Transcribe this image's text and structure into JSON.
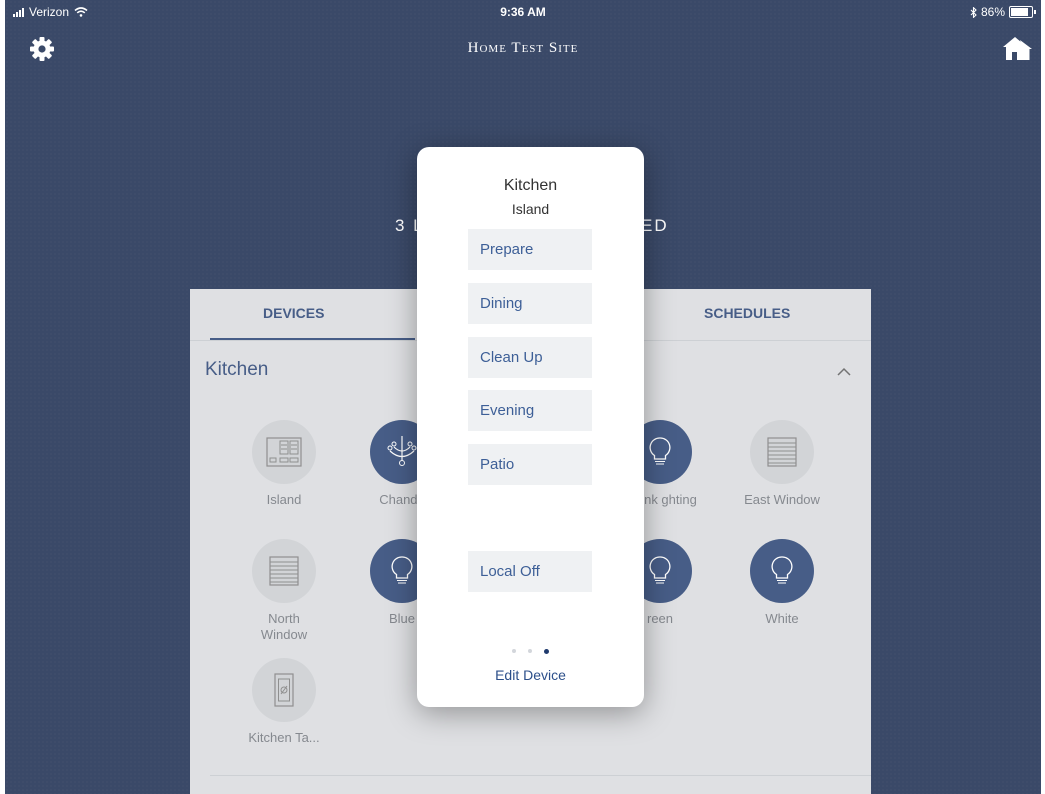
{
  "status": {
    "carrier": "Verizon",
    "time": "9:36 AM",
    "battery": "86%"
  },
  "nav": {
    "title": "Home Test Site",
    "settings_icon": "gear-icon",
    "homes_icon": "homes-icon"
  },
  "summary": {
    "left": "3 L",
    "right": "ED"
  },
  "tabs": {
    "devices": "DEVICES",
    "schedules": "SCHEDULES"
  },
  "room": {
    "name": "Kitchen"
  },
  "devices": [
    {
      "label": "Island",
      "icon": "keypad-icon",
      "on": false
    },
    {
      "label": "Chande",
      "icon": "chandelier-icon",
      "on": true
    },
    {
      "label": "ersink\nghting",
      "icon": "bulb-icon",
      "on": true
    },
    {
      "label": "East Window",
      "icon": "shade-icon",
      "on": false
    },
    {
      "label": "North\nWindow",
      "icon": "shade-icon",
      "on": false
    },
    {
      "label": "Blue",
      "icon": "bulb-icon",
      "on": true
    },
    {
      "label": "reen",
      "icon": "bulb-icon",
      "on": true
    },
    {
      "label": "White",
      "icon": "bulb-icon",
      "on": true
    },
    {
      "label": "Kitchen Ta...",
      "icon": "dimmer-icon",
      "on": false
    }
  ],
  "modal": {
    "title": "Kitchen",
    "subtitle": "Island",
    "scenes": [
      "Prepare",
      "Dining",
      "Clean Up",
      "Evening",
      "Patio"
    ],
    "local_off": "Local Off",
    "page_index": 3,
    "page_count": 3,
    "edit_label": "Edit Device"
  },
  "colors": {
    "background": "#0f2147",
    "accent": "#1f3a6d",
    "panel": "#d8dadd",
    "scene_button": "#eff1f3"
  }
}
